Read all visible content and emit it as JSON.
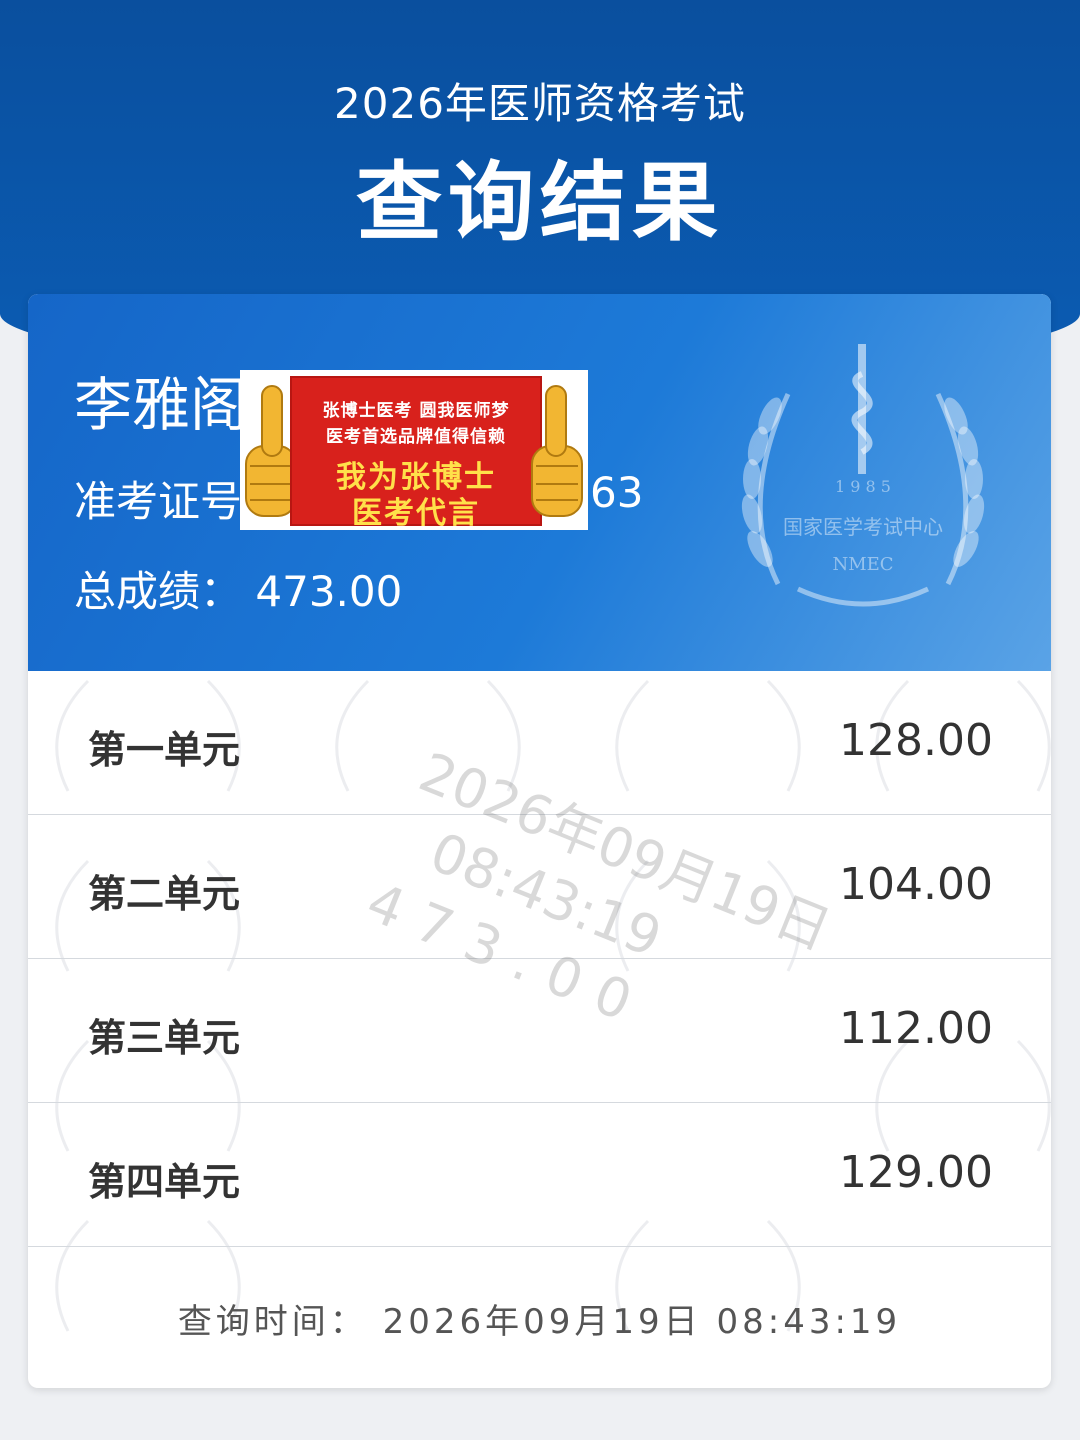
{
  "header": {
    "exam_title": "2026年医师资格考试",
    "page_title": "查询结果"
  },
  "candidate": {
    "name": "李雅阁",
    "id_label": "准考证号",
    "id_tail": "63",
    "total_label": "总成绩：",
    "total_value": "473.00"
  },
  "emblem": {
    "year": "1 9 8 5",
    "org_name": "国家医学考试中心",
    "org_abbr": "NMEC",
    "icon": "caduceus-laurel-icon"
  },
  "ad_sticker": {
    "line1": "张博士医考  圆我医师梦",
    "line2": "医考首选品牌值得信赖",
    "line3": "我为张博士",
    "line4": "医考代言",
    "icon": "thumbs-up-icon"
  },
  "units": [
    {
      "label": "第一单元",
      "score": "128.00"
    },
    {
      "label": "第二单元",
      "score": "104.00"
    },
    {
      "label": "第三单元",
      "score": "112.00"
    },
    {
      "label": "第四单元",
      "score": "129.00"
    }
  ],
  "watermark": {
    "date": "2026年09月19日",
    "time": "08:43:19",
    "score": "473.00"
  },
  "query_time": "查询时间：  2026年09月19日  08:43:19",
  "colors": {
    "header_blue": "#0a4f9e",
    "card_blue": "#1566c8",
    "ad_red": "#d8211c",
    "ad_yellow": "#ffe14a"
  }
}
